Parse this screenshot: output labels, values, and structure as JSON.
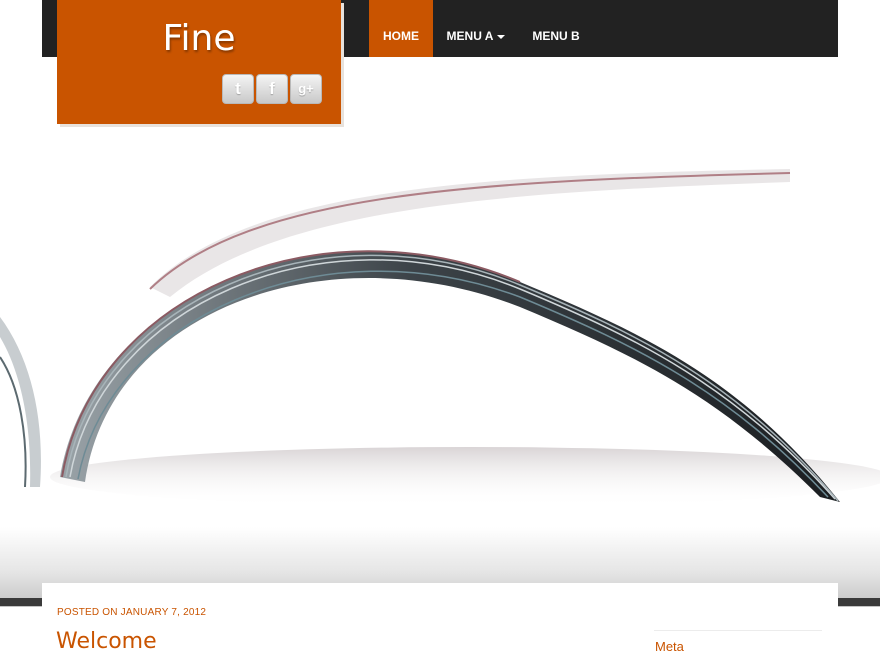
{
  "site": {
    "title": "Fine",
    "social": [
      {
        "icon": "twitter-icon",
        "glyph": "t"
      },
      {
        "icon": "facebook-icon",
        "glyph": "f"
      },
      {
        "icon": "google-plus-icon",
        "glyph": "g+"
      }
    ]
  },
  "nav": {
    "items": [
      {
        "label": "HOME",
        "active": true
      },
      {
        "label": "MENU A",
        "dropdown": true
      },
      {
        "label": "MENU B"
      }
    ]
  },
  "hero": {
    "image": "open-magazine-pages-photo"
  },
  "post": {
    "meta": "POSTED ON JANUARY 7, 2012",
    "title": "Welcome"
  },
  "sidebar": {
    "title": "Meta"
  },
  "colors": {
    "accent": "#c95400",
    "bar": "#222222"
  }
}
